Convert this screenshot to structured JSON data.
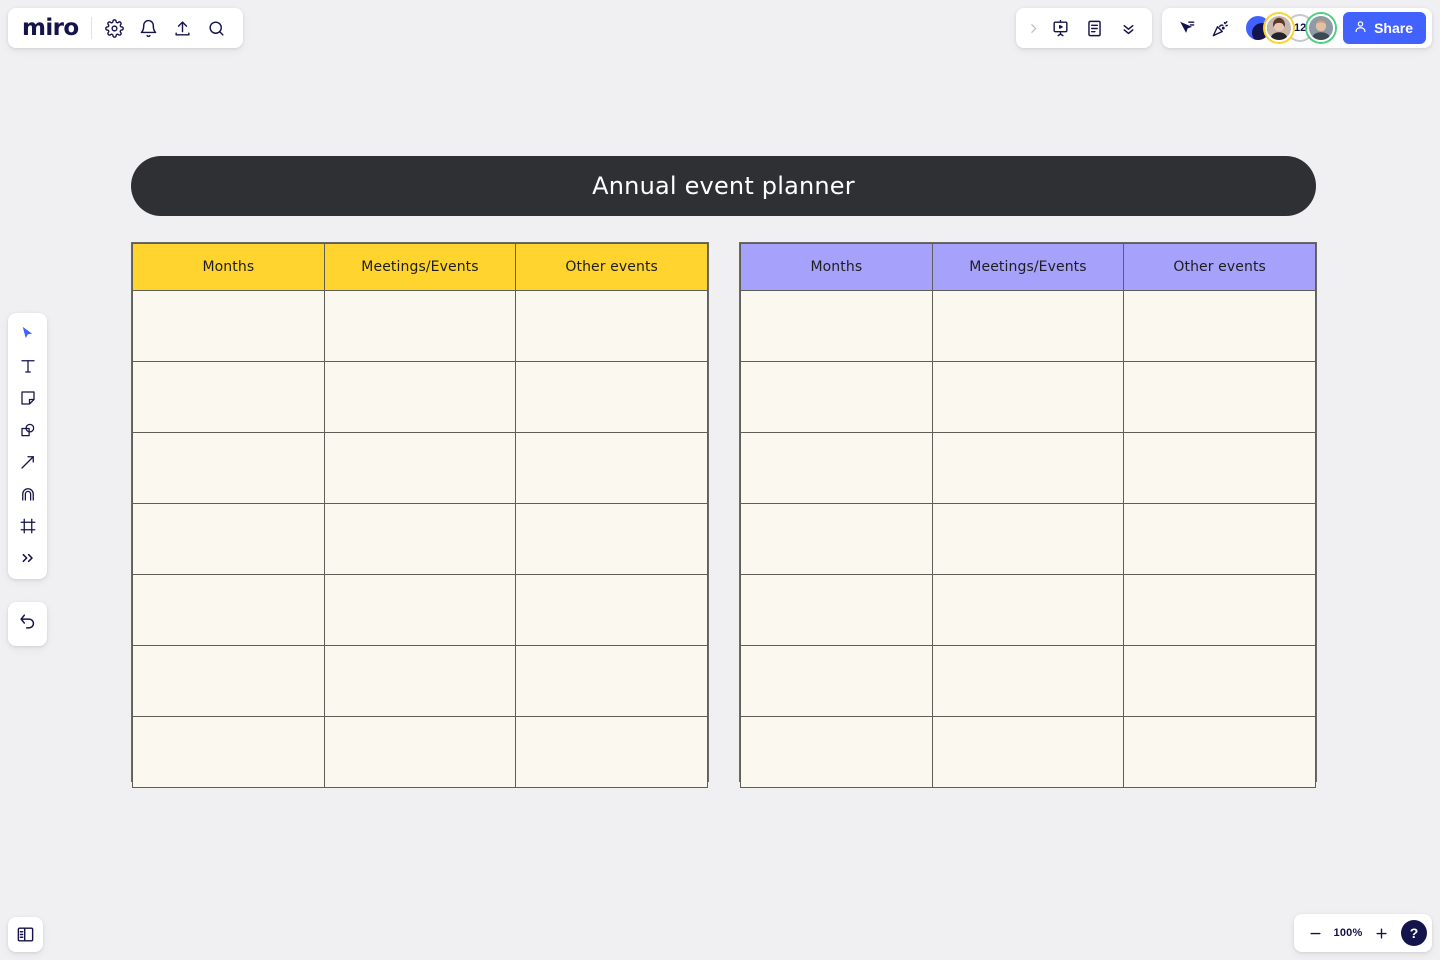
{
  "app": {
    "brand": "miro"
  },
  "topbar_left": {
    "icons": [
      {
        "name": "settings-gear-icon",
        "label": "Settings"
      },
      {
        "name": "notifications-bell-icon",
        "label": "Notifications"
      },
      {
        "name": "upload-icon",
        "label": "Upload"
      },
      {
        "name": "search-icon",
        "label": "Search"
      }
    ]
  },
  "topbar_right": {
    "tools_group": [
      {
        "name": "expand-chevron-right-icon",
        "label": "Expand"
      },
      {
        "name": "presentation-icon",
        "label": "Presentation mode"
      },
      {
        "name": "notes-document-icon",
        "label": "Notes"
      },
      {
        "name": "chevron-double-down-icon",
        "label": "More"
      }
    ],
    "collab_group": [
      {
        "name": "cursor-share-icon",
        "label": "Share cursor"
      },
      {
        "name": "celebrate-confetti-icon",
        "label": "Celebrate"
      }
    ],
    "avatars": [
      {
        "name": "avatar-brand",
        "type": "logo",
        "color": "#4262FF"
      },
      {
        "name": "avatar-user-1",
        "type": "photo",
        "ring": "#FFD02F"
      },
      {
        "name": "avatar-overflow-count",
        "type": "count",
        "count": "12"
      },
      {
        "name": "avatar-user-2",
        "type": "photo",
        "ring": "#4BD07E"
      }
    ],
    "share_label": "Share"
  },
  "toolbar": {
    "items": [
      {
        "name": "select-cursor-tool",
        "label": "Select",
        "active": true
      },
      {
        "name": "text-tool",
        "label": "Text"
      },
      {
        "name": "sticky-note-tool",
        "label": "Sticky note"
      },
      {
        "name": "shapes-tool",
        "label": "Shapes"
      },
      {
        "name": "connector-arrow-tool",
        "label": "Connection line"
      },
      {
        "name": "pen-tool",
        "label": "Pen"
      },
      {
        "name": "frame-tool",
        "label": "Frame"
      },
      {
        "name": "more-tools-chevrons",
        "label": "More tools"
      }
    ],
    "undo_label": "Undo"
  },
  "bottom_left": {
    "panel_toggle_label": "Open panel"
  },
  "zoom_controls": {
    "zoom_out_label": "Zoom out",
    "level": "100%",
    "zoom_in_label": "Zoom in",
    "help_label": "?"
  },
  "canvas": {
    "title": "Annual event planner",
    "title_bg": "#2F3033",
    "background": "#F0F0F2"
  },
  "tables": [
    {
      "name": "planner-table-left",
      "header_color": "#FFD42E",
      "cell_color": "#FBF9EF",
      "columns": [
        "Months",
        "Meetings/Events",
        "Other events"
      ],
      "rows": [
        [
          "",
          "",
          ""
        ],
        [
          "",
          "",
          ""
        ],
        [
          "",
          "",
          ""
        ],
        [
          "",
          "",
          ""
        ],
        [
          "",
          "",
          ""
        ],
        [
          "",
          "",
          ""
        ],
        [
          "",
          "",
          ""
        ]
      ]
    },
    {
      "name": "planner-table-right",
      "header_color": "#A6A1FA",
      "cell_color": "#FBF9EF",
      "columns": [
        "Months",
        "Meetings/Events",
        "Other events"
      ],
      "rows": [
        [
          "",
          "",
          ""
        ],
        [
          "",
          "",
          ""
        ],
        [
          "",
          "",
          ""
        ],
        [
          "",
          "",
          ""
        ],
        [
          "",
          "",
          ""
        ],
        [
          "",
          "",
          ""
        ],
        [
          "",
          "",
          ""
        ]
      ]
    }
  ]
}
